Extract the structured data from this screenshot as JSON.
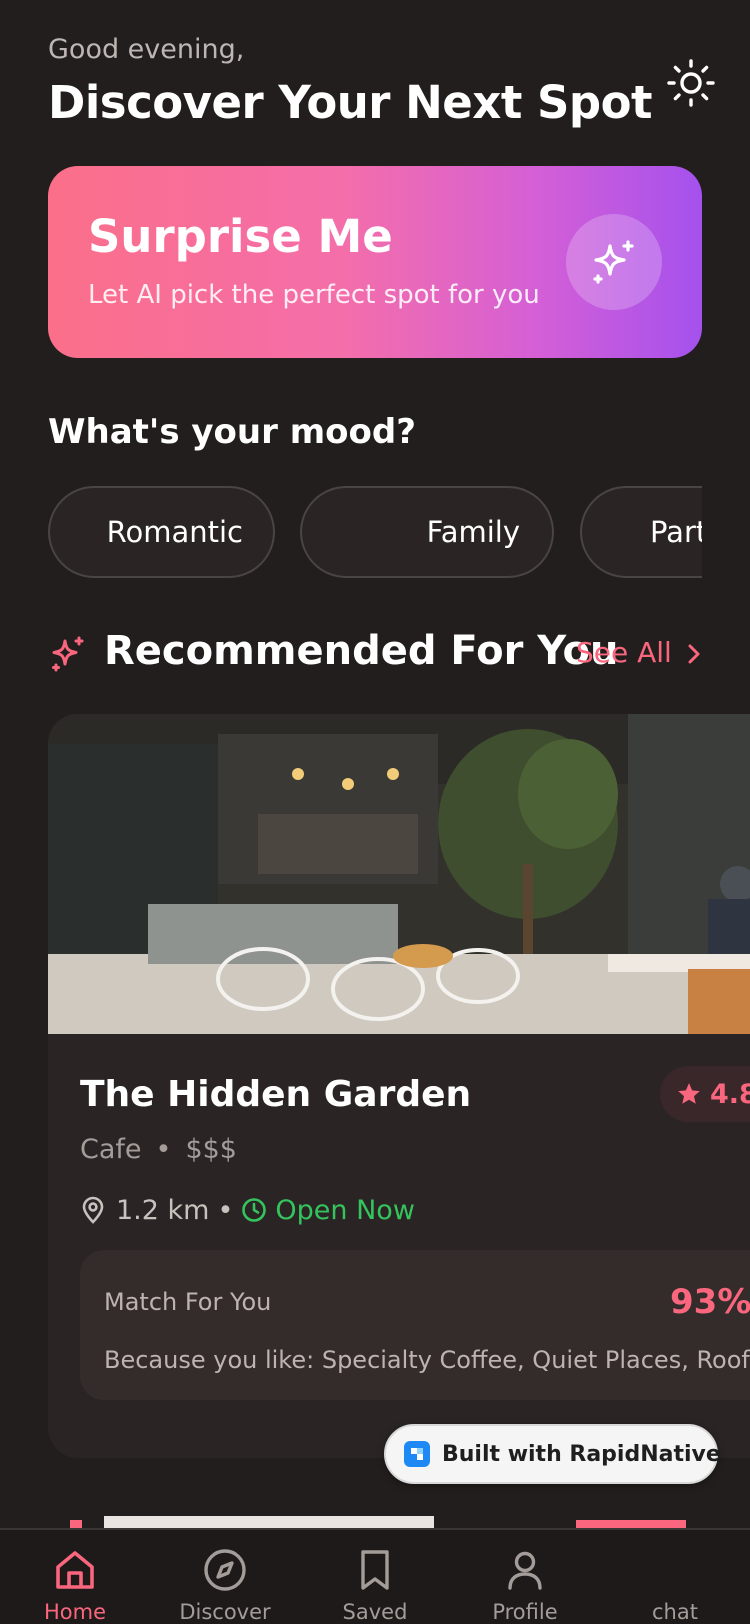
{
  "header": {
    "greeting": "Good evening,",
    "title": "Discover Your Next Spot",
    "theme_icon": "sun-icon"
  },
  "surprise": {
    "title": "Surprise Me",
    "subtitle": "Let AI pick the perfect spot for you",
    "icon": "sparkles-icon"
  },
  "mood": {
    "title": "What's your mood?",
    "chips": [
      {
        "label": "Romantic"
      },
      {
        "label": "Family"
      },
      {
        "label": "Part"
      }
    ]
  },
  "recommended": {
    "title": "Recommended For You",
    "see_all": "See All",
    "card": {
      "name": "The Hidden Garden",
      "rating": "4.8",
      "category": "Cafe",
      "price": "$$$",
      "distance": "1.2 km",
      "separator": "•",
      "status": "Open Now",
      "match_label": "Match For You",
      "match_percent": "93%",
      "because": "Because you like: Specialty Coffee, Quiet Places, Rooftops"
    }
  },
  "badge": {
    "text": "Built with RapidNative"
  },
  "tabs": [
    {
      "label": "Home",
      "icon": "home-icon",
      "active": true
    },
    {
      "label": "Discover",
      "icon": "compass-icon",
      "active": false
    },
    {
      "label": "Saved",
      "icon": "bookmark-icon",
      "active": false
    },
    {
      "label": "Profile",
      "icon": "user-icon",
      "active": false
    },
    {
      "label": "chat",
      "icon": "chat-icon",
      "active": false
    }
  ],
  "colors": {
    "background": "#221e1d",
    "accent": "#f9667e",
    "open_green": "#34c35c",
    "gradient_start": "#fb6f89",
    "gradient_end": "#a551ee"
  }
}
